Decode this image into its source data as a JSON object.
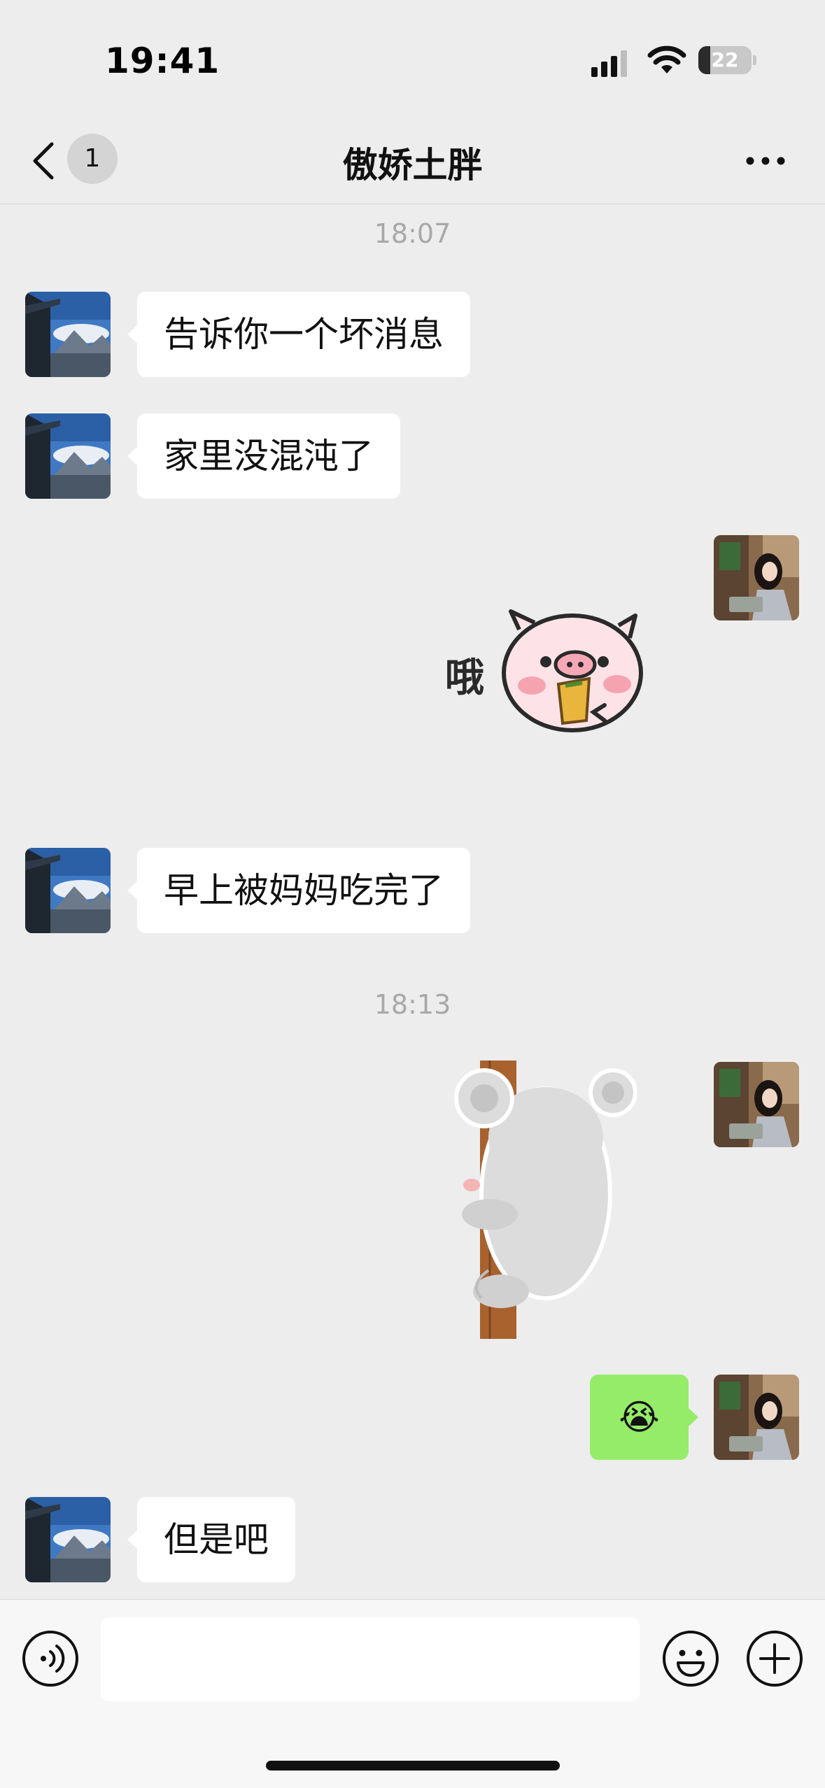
{
  "status_bar": {
    "time": "19:41",
    "battery_level": "22",
    "battery_fraction": 0.22
  },
  "nav": {
    "unread_count": "1",
    "title": "傲娇土胖",
    "icons": {
      "back": "chevron-left-icon",
      "more": "more-horizontal-icon"
    }
  },
  "chat": {
    "timestamps": [
      "18:07",
      "18:13"
    ],
    "messages": [
      {
        "side": "left",
        "type": "text",
        "text": "告诉你一个坏消息"
      },
      {
        "side": "left",
        "type": "text",
        "text": "家里没混沌了"
      },
      {
        "side": "right",
        "type": "sticker",
        "sticker": "pig-sticker",
        "caption": "哦"
      },
      {
        "side": "left",
        "type": "text",
        "text": "早上被妈妈吃完了"
      },
      {
        "side": "right",
        "type": "sticker",
        "sticker": "koala-sticker"
      },
      {
        "side": "right",
        "type": "text",
        "text": "😭"
      },
      {
        "side": "left",
        "type": "text",
        "text": "但是吧"
      }
    ]
  },
  "input_bar": {
    "placeholder": "",
    "icons": {
      "voice": "voice-icon",
      "emoji": "emoji-icon",
      "plus": "plus-circle-icon"
    }
  },
  "colors": {
    "background": "#ededed",
    "bubble_self": "#95ec69",
    "bubble_other": "#ffffff",
    "timestamp": "#a8a8a8"
  }
}
